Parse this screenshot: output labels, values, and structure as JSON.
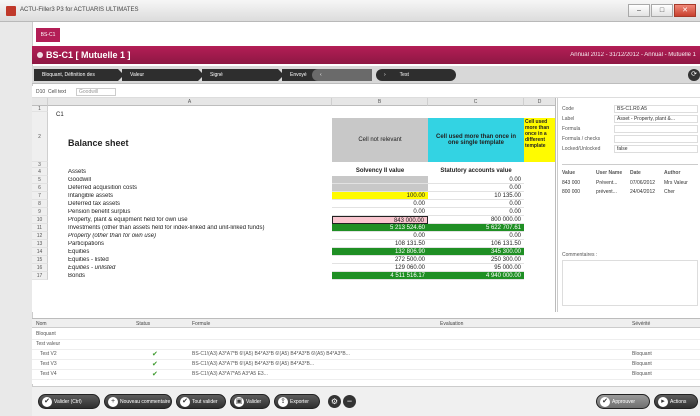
{
  "window": {
    "title": "ACTU-Filler3 P3 for ACTUARIS ULTIMATES"
  },
  "brand_tab": "BS-C1",
  "header": {
    "title": "BS-C1 [ Mutuelle 1 ]",
    "meta": "Annual 2012 - 31/12/2012 - Annual - Mutuelle 1"
  },
  "steps": [
    {
      "label": "Bloquant, Définition des",
      "color": "#2e2e2e"
    },
    {
      "label": "Valeur",
      "color": "#2e2e2e"
    },
    {
      "label": "Signé",
      "color": "#2e2e2e"
    },
    {
      "label": "Envoyé",
      "color": "#2e2e2e"
    },
    {
      "label": "",
      "color": "#6a6a6a"
    },
    {
      "label": "Test",
      "color": "#2e2e2e"
    }
  ],
  "cell_ref": {
    "ref": "D10",
    "label": "Cell text",
    "value": "Goodwill"
  },
  "grid": {
    "col_heads": [
      "A",
      "B",
      "C",
      "D"
    ],
    "title": "Balance sheet",
    "c1_code": "C1",
    "header_cells": {
      "not_relevant": "Cell not relevant",
      "used_more": "Cell used more than once in one single template",
      "clipped": "Cell used more than once in a different template"
    },
    "col_titles": {
      "solvency": "Solvency II value",
      "statutory": "Statutory accounts value"
    },
    "rows": [
      {
        "n": "1",
        "label": "",
        "s": "",
        "t": "",
        "style": ""
      },
      {
        "n": "2",
        "label": "",
        "s": "",
        "t": "",
        "style": ""
      },
      {
        "n": "3",
        "label": "",
        "s": "",
        "t": "",
        "style": ""
      },
      {
        "n": "4",
        "label": "Assets",
        "s": "",
        "t": "",
        "style": ""
      },
      {
        "n": "5",
        "label": "Goodwill",
        "s": "",
        "t": "0.00",
        "style": "grey"
      },
      {
        "n": "6",
        "label": "Deferred acquisition costs",
        "s": "",
        "t": "0.00",
        "style": "grey"
      },
      {
        "n": "7",
        "label": "Intangible assets",
        "s": "100.00",
        "t": "10 135.00",
        "style": "yellow"
      },
      {
        "n": "8",
        "label": "Deferred tax assets",
        "s": "0.00",
        "t": "0.00",
        "style": ""
      },
      {
        "n": "9",
        "label": "Pension benefit surplus",
        "s": "0.00",
        "t": "0.00",
        "style": ""
      },
      {
        "n": "10",
        "label": "Property, plant & equipment held for own use",
        "s": "843 000.00",
        "t": "800 000.00",
        "style": "pink"
      },
      {
        "n": "11",
        "label": "Investments (other than assets held for index-linked and unit-linked funds)",
        "s": "5 213 524.60",
        "t": "5 622 707.61",
        "style": "green"
      },
      {
        "n": "12",
        "label": "Property (other than for own use)",
        "s": "0.00",
        "t": "0.00",
        "style": "italic"
      },
      {
        "n": "13",
        "label": "Participations",
        "s": "108 131.50",
        "t": "106 131.50",
        "style": ""
      },
      {
        "n": "14",
        "label": "Equities",
        "s": "132 806.90",
        "t": "345 300.00",
        "style": "green"
      },
      {
        "n": "15",
        "label": "Equities - listed",
        "s": "272 500.00",
        "t": "250 300.00",
        "style": ""
      },
      {
        "n": "16",
        "label": "Equities - unlisted",
        "s": "129 060.00",
        "t": "95 000.00",
        "style": "italic"
      },
      {
        "n": "17",
        "label": "Bonds",
        "s": "4 511 516.17",
        "t": "4 940 000.00",
        "style": "green"
      }
    ]
  },
  "side_panel": {
    "props": [
      {
        "label": "Code",
        "value": "BS-C1.R0.A5"
      },
      {
        "label": "Label",
        "value": "Asset - Property, plant &..."
      },
      {
        "label": "Formula",
        "value": ""
      },
      {
        "label": "Formula / checks",
        "value": ""
      },
      {
        "label": "Locked/Unlocked",
        "value": "false"
      }
    ],
    "history_heads": [
      "Value",
      "User Name",
      "Date",
      "Author"
    ],
    "history_rows": [
      [
        "843 000",
        "Prévent...",
        "07/06/2012",
        "Mrs Valeur"
      ],
      [
        "800 000",
        "prévent...",
        "24/04/2012",
        "Cher"
      ]
    ],
    "comments_label": "Commentaires :"
  },
  "bottom_table": {
    "heads": [
      "Nom",
      "Status",
      "Formule",
      "Evaluation",
      "Sévérité"
    ],
    "rows": [
      {
        "name": "Bloquant",
        "status": "",
        "formula": "",
        "severity": "",
        "check": false
      },
      {
        "name": "Test valeur",
        "status": "",
        "formula": "",
        "severity": "",
        "check": false
      },
      {
        "name": "Test V2",
        "status": "ok",
        "formula": "BS-C1!(A3) A3*A7*B 6!(A5) B4*A3*B 6!(A5) B4*A3*B 6!(A5) B4*A3*B...",
        "severity": "Bloquant",
        "check": true
      },
      {
        "name": "Test V3",
        "status": "ok",
        "formula": "BS-C1!(A3) A3*A7*B 6!(A5) B4*A3*B 6!(A5) B4*A3*B...",
        "severity": "Bloquant",
        "check": true
      },
      {
        "name": "Test V4",
        "status": "ok",
        "formula": "BS-C1!(A3) A3*A7*A5 A3*A5 E3...",
        "severity": "Bloquant",
        "check": true
      }
    ]
  },
  "toolbar": {
    "validate": "Valider (Ctrl)",
    "new_comment": "Nouveau commentaire",
    "validate_all": "Tout valider",
    "save": "Valider",
    "export": "Exporter",
    "approve": "Approuver",
    "actions": "Actions"
  },
  "colors": {
    "accent": "#b31e56",
    "green": "#1f8f24",
    "yellow": "#fffb00",
    "cyan": "#33d3e3",
    "grey": "#c8c8c8"
  }
}
